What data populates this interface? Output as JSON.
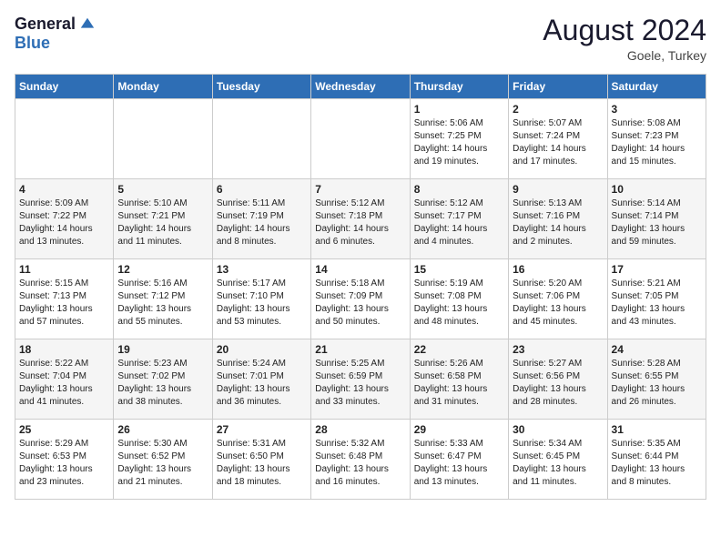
{
  "header": {
    "logo_general": "General",
    "logo_blue": "Blue",
    "month_title": "August 2024",
    "location": "Goele, Turkey"
  },
  "weekdays": [
    "Sunday",
    "Monday",
    "Tuesday",
    "Wednesday",
    "Thursday",
    "Friday",
    "Saturday"
  ],
  "weeks": [
    [
      {
        "day": "",
        "info": ""
      },
      {
        "day": "",
        "info": ""
      },
      {
        "day": "",
        "info": ""
      },
      {
        "day": "",
        "info": ""
      },
      {
        "day": "1",
        "info": "Sunrise: 5:06 AM\nSunset: 7:25 PM\nDaylight: 14 hours\nand 19 minutes."
      },
      {
        "day": "2",
        "info": "Sunrise: 5:07 AM\nSunset: 7:24 PM\nDaylight: 14 hours\nand 17 minutes."
      },
      {
        "day": "3",
        "info": "Sunrise: 5:08 AM\nSunset: 7:23 PM\nDaylight: 14 hours\nand 15 minutes."
      }
    ],
    [
      {
        "day": "4",
        "info": "Sunrise: 5:09 AM\nSunset: 7:22 PM\nDaylight: 14 hours\nand 13 minutes."
      },
      {
        "day": "5",
        "info": "Sunrise: 5:10 AM\nSunset: 7:21 PM\nDaylight: 14 hours\nand 11 minutes."
      },
      {
        "day": "6",
        "info": "Sunrise: 5:11 AM\nSunset: 7:19 PM\nDaylight: 14 hours\nand 8 minutes."
      },
      {
        "day": "7",
        "info": "Sunrise: 5:12 AM\nSunset: 7:18 PM\nDaylight: 14 hours\nand 6 minutes."
      },
      {
        "day": "8",
        "info": "Sunrise: 5:12 AM\nSunset: 7:17 PM\nDaylight: 14 hours\nand 4 minutes."
      },
      {
        "day": "9",
        "info": "Sunrise: 5:13 AM\nSunset: 7:16 PM\nDaylight: 14 hours\nand 2 minutes."
      },
      {
        "day": "10",
        "info": "Sunrise: 5:14 AM\nSunset: 7:14 PM\nDaylight: 13 hours\nand 59 minutes."
      }
    ],
    [
      {
        "day": "11",
        "info": "Sunrise: 5:15 AM\nSunset: 7:13 PM\nDaylight: 13 hours\nand 57 minutes."
      },
      {
        "day": "12",
        "info": "Sunrise: 5:16 AM\nSunset: 7:12 PM\nDaylight: 13 hours\nand 55 minutes."
      },
      {
        "day": "13",
        "info": "Sunrise: 5:17 AM\nSunset: 7:10 PM\nDaylight: 13 hours\nand 53 minutes."
      },
      {
        "day": "14",
        "info": "Sunrise: 5:18 AM\nSunset: 7:09 PM\nDaylight: 13 hours\nand 50 minutes."
      },
      {
        "day": "15",
        "info": "Sunrise: 5:19 AM\nSunset: 7:08 PM\nDaylight: 13 hours\nand 48 minutes."
      },
      {
        "day": "16",
        "info": "Sunrise: 5:20 AM\nSunset: 7:06 PM\nDaylight: 13 hours\nand 45 minutes."
      },
      {
        "day": "17",
        "info": "Sunrise: 5:21 AM\nSunset: 7:05 PM\nDaylight: 13 hours\nand 43 minutes."
      }
    ],
    [
      {
        "day": "18",
        "info": "Sunrise: 5:22 AM\nSunset: 7:04 PM\nDaylight: 13 hours\nand 41 minutes."
      },
      {
        "day": "19",
        "info": "Sunrise: 5:23 AM\nSunset: 7:02 PM\nDaylight: 13 hours\nand 38 minutes."
      },
      {
        "day": "20",
        "info": "Sunrise: 5:24 AM\nSunset: 7:01 PM\nDaylight: 13 hours\nand 36 minutes."
      },
      {
        "day": "21",
        "info": "Sunrise: 5:25 AM\nSunset: 6:59 PM\nDaylight: 13 hours\nand 33 minutes."
      },
      {
        "day": "22",
        "info": "Sunrise: 5:26 AM\nSunset: 6:58 PM\nDaylight: 13 hours\nand 31 minutes."
      },
      {
        "day": "23",
        "info": "Sunrise: 5:27 AM\nSunset: 6:56 PM\nDaylight: 13 hours\nand 28 minutes."
      },
      {
        "day": "24",
        "info": "Sunrise: 5:28 AM\nSunset: 6:55 PM\nDaylight: 13 hours\nand 26 minutes."
      }
    ],
    [
      {
        "day": "25",
        "info": "Sunrise: 5:29 AM\nSunset: 6:53 PM\nDaylight: 13 hours\nand 23 minutes."
      },
      {
        "day": "26",
        "info": "Sunrise: 5:30 AM\nSunset: 6:52 PM\nDaylight: 13 hours\nand 21 minutes."
      },
      {
        "day": "27",
        "info": "Sunrise: 5:31 AM\nSunset: 6:50 PM\nDaylight: 13 hours\nand 18 minutes."
      },
      {
        "day": "28",
        "info": "Sunrise: 5:32 AM\nSunset: 6:48 PM\nDaylight: 13 hours\nand 16 minutes."
      },
      {
        "day": "29",
        "info": "Sunrise: 5:33 AM\nSunset: 6:47 PM\nDaylight: 13 hours\nand 13 minutes."
      },
      {
        "day": "30",
        "info": "Sunrise: 5:34 AM\nSunset: 6:45 PM\nDaylight: 13 hours\nand 11 minutes."
      },
      {
        "day": "31",
        "info": "Sunrise: 5:35 AM\nSunset: 6:44 PM\nDaylight: 13 hours\nand 8 minutes."
      }
    ]
  ]
}
